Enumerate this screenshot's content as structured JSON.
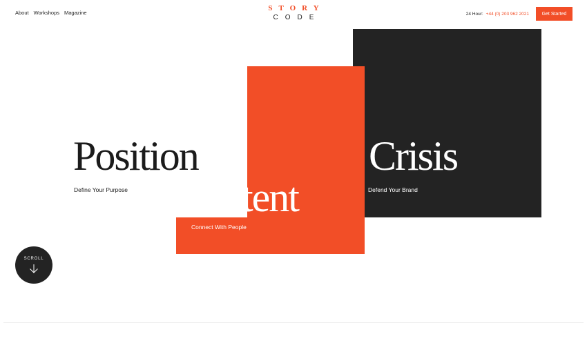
{
  "nav": {
    "items": [
      {
        "label": "About"
      },
      {
        "label": "Workshops"
      },
      {
        "label": "Magazine"
      }
    ]
  },
  "logo": {
    "top": "STORY",
    "bottom": "CODE"
  },
  "header": {
    "hour_label": "24 Hour:",
    "phone": "+44 (0) 203 962 2021",
    "cta_label": "Get Started"
  },
  "hero": {
    "panels": [
      {
        "title": "Position",
        "subtitle": "Define Your Purpose"
      },
      {
        "title": "Content",
        "visible_title": "ntent",
        "subtitle": "Connect With People"
      },
      {
        "title": "Crisis",
        "subtitle": "Defend Your Brand"
      }
    ]
  },
  "scroll": {
    "label": "SCROLL",
    "icon": "arrow-down-icon"
  },
  "colors": {
    "accent": "#f24e27",
    "dark": "#232323",
    "background": "#ffffff"
  }
}
